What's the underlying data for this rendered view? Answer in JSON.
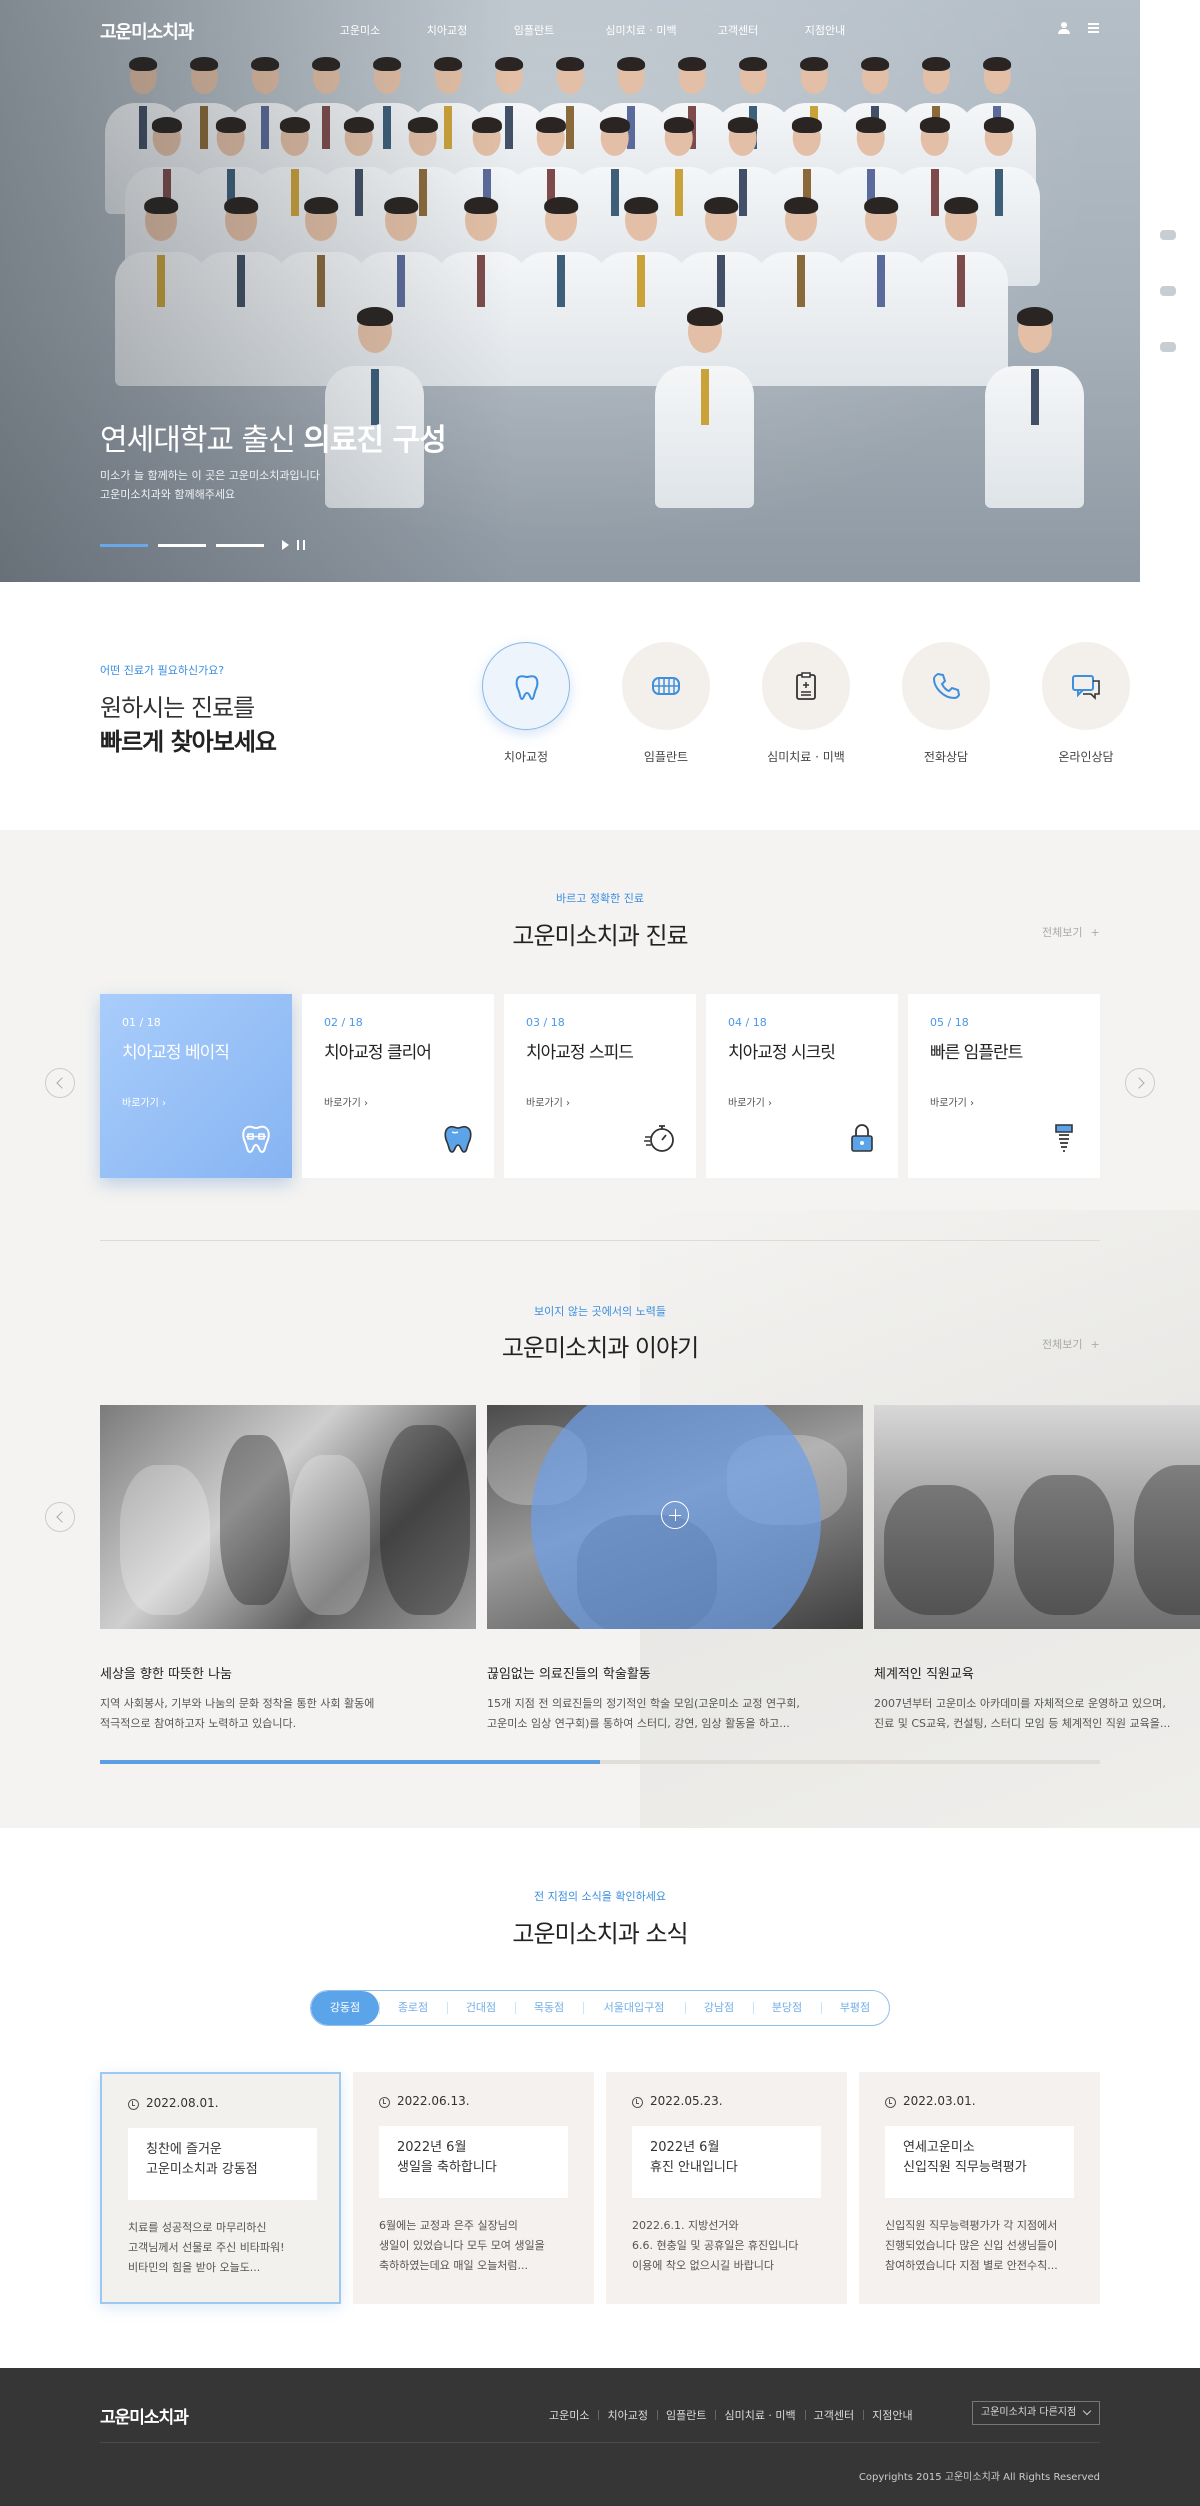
{
  "header": {
    "logo": "고운미소치과",
    "nav": [
      "고운미소",
      "치아교정",
      "임플란트",
      "심미치료 · 미백",
      "고객센터",
      "지점안내"
    ]
  },
  "hero": {
    "title_regular": "연세대학교 출신 ",
    "title_bold": "의료진 구성",
    "sub_line1": "미소가 늘 함께하는 이 곳은 고운미소치과입니다",
    "sub_line2": "고운미소치과와 함께해주세요"
  },
  "quick": {
    "eyebrow": "어떤 진료가 필요하신가요?",
    "title_line1": "원하시는 진료를",
    "title_line2": "빠르게 찾아보세요",
    "items": [
      {
        "label": "치아교정",
        "icon": "tooth-icon"
      },
      {
        "label": "임플란트",
        "icon": "implant-teeth-icon"
      },
      {
        "label": "심미치료 · 미백",
        "icon": "clipboard-icon"
      },
      {
        "label": "전화상담",
        "icon": "phone-icon"
      },
      {
        "label": "온라인상담",
        "icon": "chat-icon"
      }
    ]
  },
  "treatments": {
    "eyebrow": "바르고 정확한 진료",
    "title": "고운미소치과 진료",
    "more": "전체보기",
    "cards": [
      {
        "num": "01 / 18",
        "title": "치아교정 베이직",
        "go": "바로가기",
        "icon": "braces-tooth-icon"
      },
      {
        "num": "02 / 18",
        "title": "치아교정 클리어",
        "go": "바로가기",
        "icon": "tooth-icon"
      },
      {
        "num": "03 / 18",
        "title": "치아교정 스피드",
        "go": "바로가기",
        "icon": "stopwatch-icon"
      },
      {
        "num": "04 / 18",
        "title": "치아교정 시크릿",
        "go": "바로가기",
        "icon": "lock-icon"
      },
      {
        "num": "05 / 18",
        "title": "빠른 임플란트",
        "go": "바로가기",
        "icon": "implant-icon"
      }
    ]
  },
  "stories": {
    "eyebrow": "보이지 않는 곳에서의 노력들",
    "title": "고운미소치과 이야기",
    "more": "전체보기",
    "items": [
      {
        "title": "세상을 향한 따뜻한 나눔",
        "line1": "지역 사회봉사, 기부와 나눔의 문화 정착을 통한 사회 활동에",
        "line2": "적극적으로 참여하고자 노력하고 있습니다."
      },
      {
        "title": "끊임없는 의료진들의 학술활동",
        "line1": "15개 지점 전 의료진들의 정기적인 학술 모임(고운미소 교정 연구회,",
        "line2": "고운미소 임상 연구회)를 통하여 스터디, 강연, 임상 활동을 하고..."
      },
      {
        "title": "체계적인 직원교육",
        "line1": "2007년부터 고운미소 아카데미를 자체적으로 운영하고 있으며,",
        "line2": "진료 및 CS교육, 컨설팅, 스터디 모임 등 체계적인 직원 교육을..."
      }
    ],
    "progress": 0.5
  },
  "news": {
    "eyebrow": "전 지점의 소식을 확인하세요",
    "title": "고운미소치과 소식",
    "tabs": [
      "강동점",
      "종로점",
      "건대점",
      "목동점",
      "서울대입구점",
      "강남점",
      "분당점",
      "부평점"
    ],
    "cards": [
      {
        "date": "2022.08.01.",
        "box1": "칭찬에 즐거운",
        "box2": "고운미소치과 강동점",
        "d1": "치료를 성공적으로 마무리하신",
        "d2": "고객님께서 선물로 주신 비타파워!",
        "d3": "비타민의 힘을 받아 오늘도..."
      },
      {
        "date": "2022.06.13.",
        "box1": "2022년 6월",
        "box2": "생일을 축하합니다",
        "d1": "6월에는 교정과 은주 실장님의",
        "d2": "생일이 있었습니다 모두 모여 생일을",
        "d3": "축하하였는데요 매일 오늘처럼..."
      },
      {
        "date": "2022.05.23.",
        "box1": "2022년 6월",
        "box2": "휴진 안내입니다",
        "d1": "2022.6.1. 지방선거와",
        "d2": "6.6. 현충일 및 공휴일은 휴진입니다",
        "d3": "이용에 착오 없으시길 바랍니다"
      },
      {
        "date": "2022.03.01.",
        "box1": "연세고운미소",
        "box2": "신입직원 직무능력평가",
        "d1": "신입직원 직무능력평가가 각 지점에서",
        "d2": "진행되었습니다 많은 신입 선생님들이",
        "d3": "참여하였습니다 지점 별로 안전수칙..."
      }
    ]
  },
  "footer": {
    "logo": "고운미소치과",
    "menu": [
      "고운미소",
      "치아교정",
      "임플란트",
      "심미치료 · 미백",
      "고객센터",
      "지점안내"
    ],
    "select": "고운미소치과 다른지점",
    "copyright": "Copyrights 2015 고운미소치과 All Rights Reserved"
  },
  "colors": {
    "accent": "#5ca4ea",
    "footer": "#363636",
    "section_bg": "#f4f3f1"
  }
}
